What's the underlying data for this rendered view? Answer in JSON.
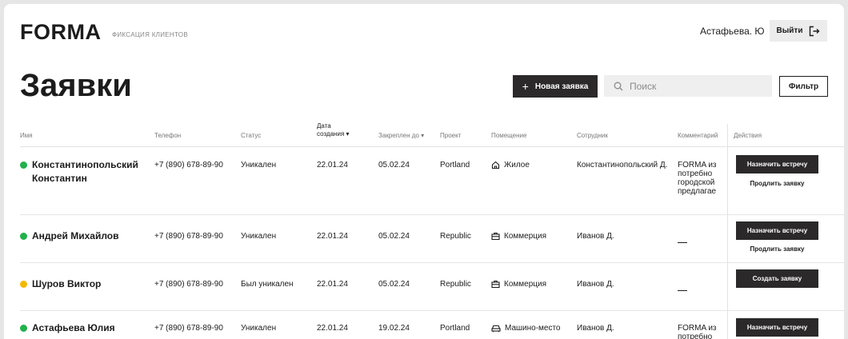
{
  "header": {
    "logo": "FORMA",
    "logo_sub": "ФИКСАЦИЯ КЛИЕНТОВ",
    "user": "Астафьева. Ю",
    "logout_label": "Выйти"
  },
  "toolbar": {
    "title": "Заявки",
    "new_request_label": "Новая заявка",
    "search_placeholder": "Поиск",
    "filter_label": "Фильтр"
  },
  "table": {
    "columns": {
      "name": "Имя",
      "phone": "Телефон",
      "status": "Статус",
      "created_line1": "Дата",
      "created_line2": "создания",
      "pinned": "Закреплен до",
      "project": "Проект",
      "room": "Помещение",
      "employee": "Сотрудник",
      "comment": "Комментарий",
      "actions": "Действия"
    },
    "rows": [
      {
        "name": "Константинопольский Константин",
        "status_color": "#22b14c",
        "phone": "+7 (890) 678-89-90",
        "status": "Уникален",
        "created": "22.01.24",
        "pinned": "05.02.24",
        "project": "Portland",
        "room": "Жилое",
        "room_icon": "home-icon",
        "employee": "Константинопольский Д.",
        "comment": "FORMA из потребно городской предлагае",
        "action_primary": "Назначить встречу",
        "action_secondary": "Продлить заявку"
      },
      {
        "name": "Андрей Михайлов",
        "status_color": "#22b14c",
        "phone": "+7 (890) 678-89-90",
        "status": "Уникален",
        "created": "22.01.24",
        "pinned": "05.02.24",
        "project": "Republic",
        "room": "Коммерция",
        "room_icon": "briefcase-icon",
        "employee": "Иванов Д.",
        "comment": "—",
        "action_primary": "Назначить встречу",
        "action_secondary": "Продлить заявку"
      },
      {
        "name": "Шуров Виктор",
        "status_color": "#f5b800",
        "phone": "+7 (890) 678-89-90",
        "status": "Был уникален",
        "created": "22.01.24",
        "pinned": "05.02.24",
        "project": "Republic",
        "room": "Коммерция",
        "room_icon": "briefcase-icon",
        "employee": "Иванов Д.",
        "comment": "—",
        "action_primary": "Создать заявку"
      },
      {
        "name": "Астафьева Юлия",
        "status_color": "#22b14c",
        "phone": "+7 (890) 678-89-90",
        "status": "Уникален",
        "created": "22.01.24",
        "pinned": "19.02.24",
        "project": "Portland",
        "room": "Машино-место",
        "room_icon": "car-icon",
        "employee": "Иванов Д.",
        "comment": "FORMA из потребно",
        "action_primary": "Назначить встречу"
      }
    ]
  }
}
